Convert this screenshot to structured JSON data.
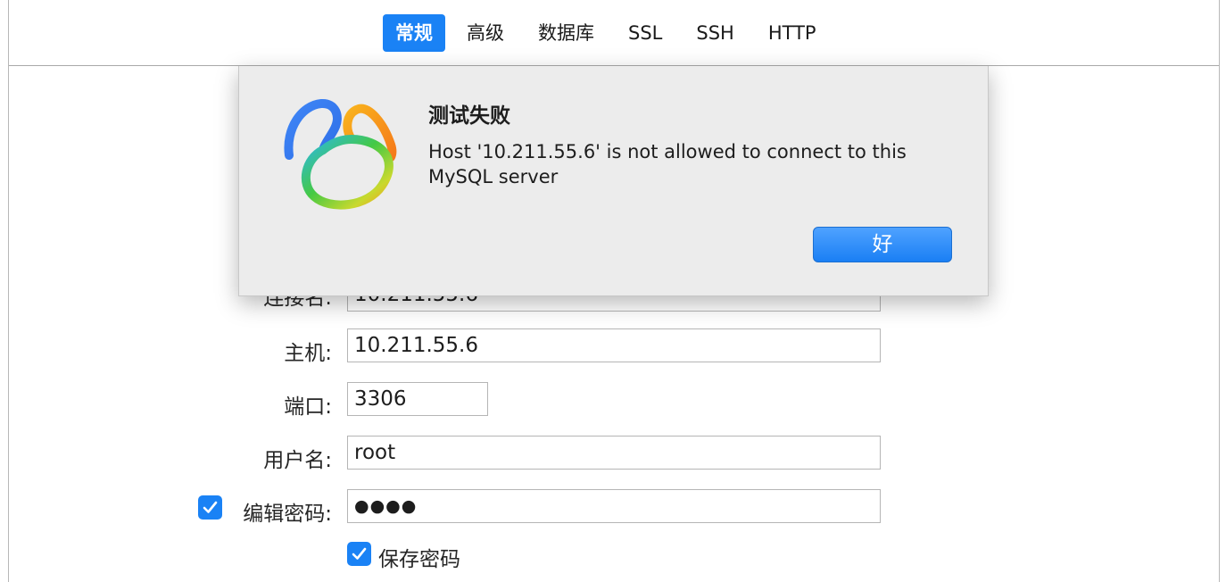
{
  "tabs": [
    {
      "label": "常规",
      "active": true
    },
    {
      "label": "高级",
      "active": false
    },
    {
      "label": "数据库",
      "active": false
    },
    {
      "label": "SSL",
      "active": false
    },
    {
      "label": "SSH",
      "active": false
    },
    {
      "label": "HTTP",
      "active": false
    }
  ],
  "form": {
    "connection_name_label": "连接名:",
    "connection_name_value": "10.211.55.6",
    "host_label": "主机:",
    "host_value": "10.211.55.6",
    "port_label": "端口:",
    "port_value": "3306",
    "username_label": "用户名:",
    "username_value": "root",
    "edit_password_label": "编辑密码:",
    "edit_password_checked": true,
    "password_value": "●●●●",
    "save_password_label": "保存密码",
    "save_password_checked": true
  },
  "alert": {
    "title": "测试失败",
    "message": "Host '10.211.55.6' is not allowed to connect to this MySQL server",
    "ok_label": "好"
  },
  "colors": {
    "accent": "#1a82f5"
  }
}
